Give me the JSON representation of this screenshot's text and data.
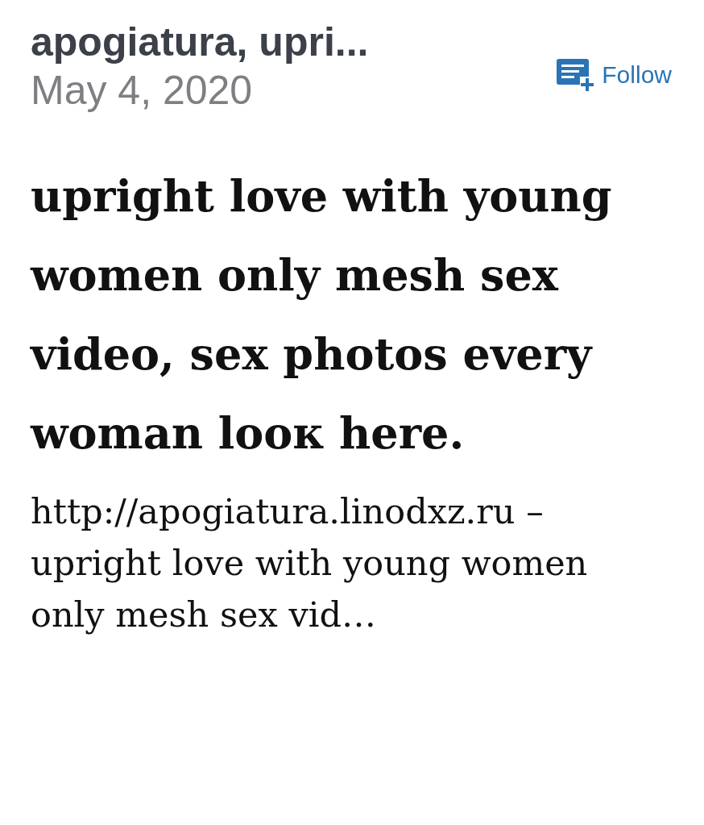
{
  "post": {
    "author": "apogiatura, upri...",
    "date": "May 4, 2020",
    "follow_button": {
      "label": "Follow"
    },
    "title": "upright love with young women only mesh sex video, sex photos every woman looк here.",
    "excerpt": "http://apogiatura.linodxz.ru – upright love with young women only mesh sex vid…"
  }
}
